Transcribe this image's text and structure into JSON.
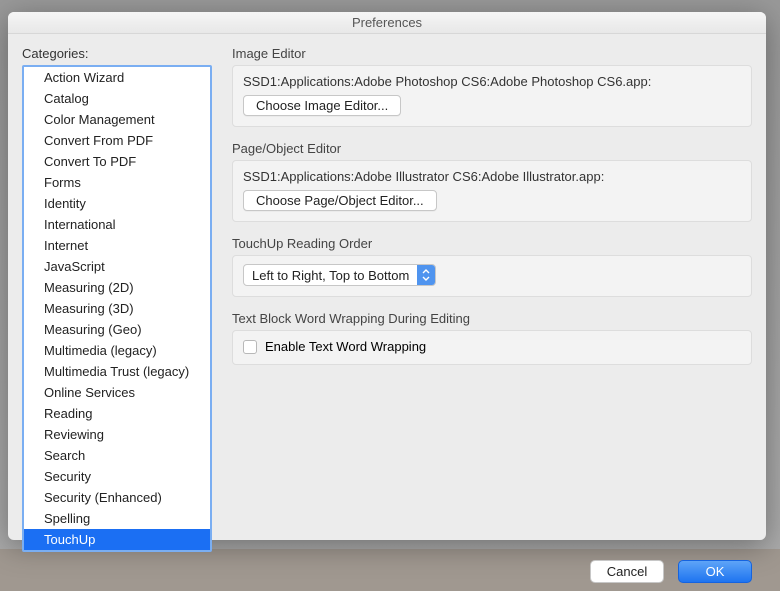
{
  "window": {
    "title": "Preferences"
  },
  "categories": {
    "label": "Categories:",
    "items": [
      "Action Wizard",
      "Catalog",
      "Color Management",
      "Convert From PDF",
      "Convert To PDF",
      "Forms",
      "Identity",
      "International",
      "Internet",
      "JavaScript",
      "Measuring (2D)",
      "Measuring (3D)",
      "Measuring (Geo)",
      "Multimedia (legacy)",
      "Multimedia Trust (legacy)",
      "Online Services",
      "Reading",
      "Reviewing",
      "Search",
      "Security",
      "Security (Enhanced)",
      "Spelling",
      "TouchUp"
    ],
    "selected_index": 22
  },
  "sections": {
    "image_editor": {
      "label": "Image Editor",
      "path": "SSD1:Applications:Adobe Photoshop CS6:Adobe Photoshop CS6.app:",
      "button": "Choose Image Editor..."
    },
    "page_editor": {
      "label": "Page/Object Editor",
      "path": "SSD1:Applications:Adobe Illustrator CS6:Adobe Illustrator.app:",
      "button": "Choose Page/Object Editor..."
    },
    "reading_order": {
      "label": "TouchUp Reading Order",
      "selected": "Left to Right, Top to Bottom"
    },
    "word_wrap": {
      "label": "Text Block Word Wrapping During Editing",
      "checkbox_label": "Enable Text Word Wrapping",
      "checked": false
    }
  },
  "footer": {
    "cancel": "Cancel",
    "ok": "OK"
  }
}
